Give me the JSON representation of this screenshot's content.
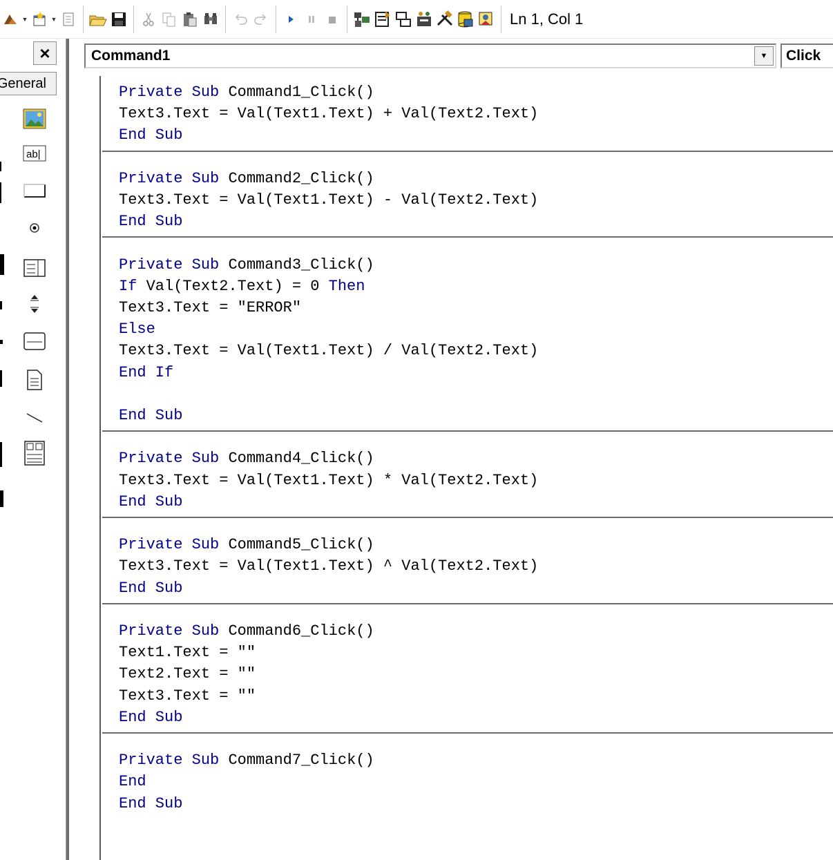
{
  "toolbar": {
    "status": "Ln 1, Col 1",
    "icons": [
      "add-project-icon",
      "add-form-icon",
      "menu-editor-icon",
      "open-icon",
      "save-icon",
      "cut-icon",
      "copy-icon",
      "paste-icon",
      "find-icon",
      "undo-icon",
      "redo-icon",
      "start-icon",
      "break-icon",
      "end-icon",
      "project-explorer-icon",
      "properties-icon",
      "form-layout-icon",
      "object-browser-icon",
      "toolbox-icon",
      "data-view-icon",
      "component-manager-icon"
    ]
  },
  "toolbox": {
    "close_label": "×",
    "tab_label": "General"
  },
  "code_window": {
    "object": "Command1",
    "procedure": "Click",
    "lines": [
      [
        {
          "t": "Private Sub ",
          "k": true
        },
        {
          "t": "Command1_Click()"
        }
      ],
      [
        {
          "t": "Text3.Text = Val(Text1.Text) + Val(Text2.Text)"
        }
      ],
      [
        {
          "t": "End Sub",
          "k": true
        }
      ],
      null,
      [
        {
          "t": "Private Sub ",
          "k": true
        },
        {
          "t": "Command2_Click()"
        }
      ],
      [
        {
          "t": "Text3.Text = Val(Text1.Text) - Val(Text2.Text)"
        }
      ],
      [
        {
          "t": "End Sub",
          "k": true
        }
      ],
      null,
      [
        {
          "t": "Private Sub ",
          "k": true
        },
        {
          "t": "Command3_Click()"
        }
      ],
      [
        {
          "t": "If ",
          "k": true
        },
        {
          "t": "Val(Text2.Text) = 0 "
        },
        {
          "t": "Then",
          "k": true
        }
      ],
      [
        {
          "t": "Text3.Text = \"ERROR\""
        }
      ],
      [
        {
          "t": "Else",
          "k": true
        }
      ],
      [
        {
          "t": "Text3.Text = Val(Text1.Text) / Val(Text2.Text)"
        }
      ],
      [
        {
          "t": "End If",
          "k": true
        }
      ],
      [],
      [
        {
          "t": "End Sub",
          "k": true
        }
      ],
      null,
      [
        {
          "t": "Private Sub ",
          "k": true
        },
        {
          "t": "Command4_Click()"
        }
      ],
      [
        {
          "t": "Text3.Text = Val(Text1.Text) * Val(Text2.Text)"
        }
      ],
      [
        {
          "t": "End Sub",
          "k": true
        }
      ],
      null,
      [
        {
          "t": "Private Sub ",
          "k": true
        },
        {
          "t": "Command5_Click()"
        }
      ],
      [
        {
          "t": "Text3.Text = Val(Text1.Text) ^ Val(Text2.Text)"
        }
      ],
      [
        {
          "t": "End Sub",
          "k": true
        }
      ],
      null,
      [
        {
          "t": "Private Sub ",
          "k": true
        },
        {
          "t": "Command6_Click()"
        }
      ],
      [
        {
          "t": "Text1.Text = \"\""
        }
      ],
      [
        {
          "t": "Text2.Text = \"\""
        }
      ],
      [
        {
          "t": "Text3.Text = \"\""
        }
      ],
      [
        {
          "t": "End Sub",
          "k": true
        }
      ],
      null,
      [
        {
          "t": "Private Sub ",
          "k": true
        },
        {
          "t": "Command7_Click()"
        }
      ],
      [
        {
          "t": "End",
          "k": true
        }
      ],
      [
        {
          "t": "End Sub",
          "k": true
        }
      ]
    ]
  },
  "colors": {
    "keyword": "#00008b",
    "text": "#000000"
  }
}
